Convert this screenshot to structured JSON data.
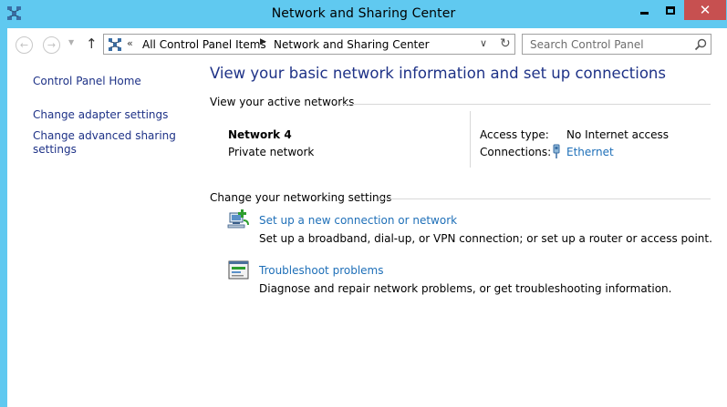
{
  "window": {
    "title": "Network and Sharing Center",
    "close_glyph": "✕"
  },
  "nav": {
    "back_glyph": "←",
    "forward_glyph": "→",
    "up_glyph": "↑",
    "address": {
      "overflow": "«",
      "crumbs": [
        "All Control Panel Items",
        "Network and Sharing Center"
      ],
      "separator": "▶",
      "dropdown_glyph": "∨",
      "refresh_glyph": "↻"
    },
    "search": {
      "placeholder": "Search Control Panel"
    }
  },
  "left_pane": {
    "items": [
      {
        "label": "Control Panel Home"
      },
      {
        "label": "Change adapter settings"
      },
      {
        "label": "Change advanced sharing settings"
      }
    ]
  },
  "main": {
    "heading": "View your basic network information and set up connections",
    "active_networks": {
      "label": "View your active networks",
      "network_name": "Network  4",
      "network_type": "Private network",
      "access_type_label": "Access type:",
      "access_type_value": "No Internet access",
      "connections_label": "Connections:",
      "connection_value": "Ethernet"
    },
    "change_settings": {
      "label": "Change your networking settings",
      "tasks": [
        {
          "link": "Set up a new connection or network",
          "description": "Set up a broadband, dial-up, or VPN connection; or set up a router or access point."
        },
        {
          "link": "Troubleshoot problems",
          "description": "Diagnose and repair network problems, or get troubleshooting information."
        }
      ]
    }
  },
  "colors": {
    "frame": "#60c9f0",
    "close_button": "#c75050",
    "link": "#1e6fb8",
    "nav_link": "#1e3287"
  }
}
